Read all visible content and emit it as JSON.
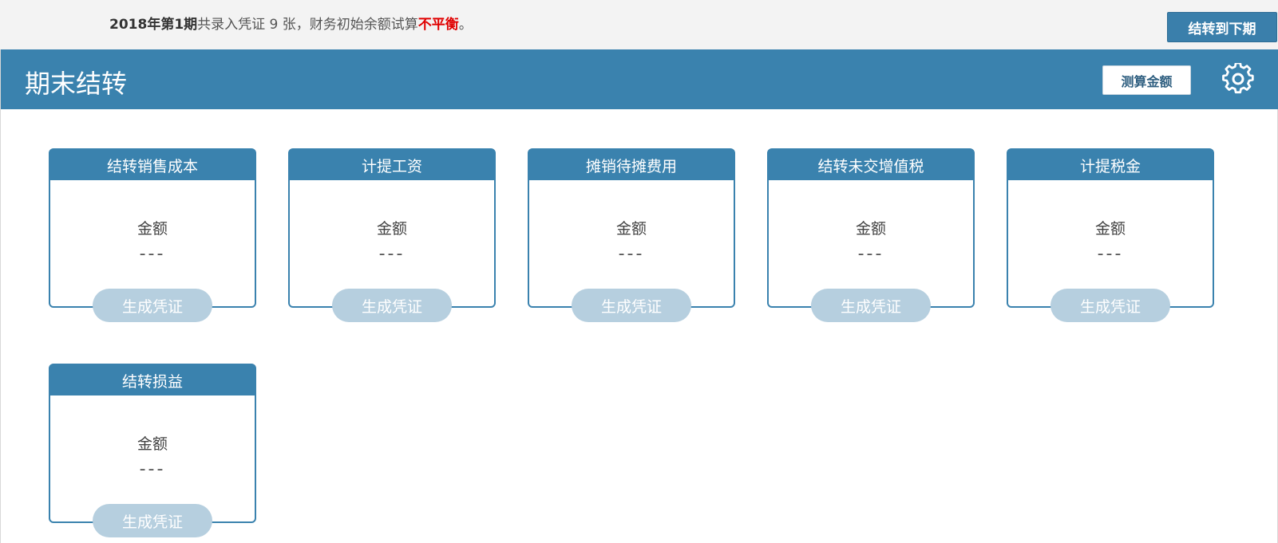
{
  "topbar": {
    "period": "2018年第1期",
    "text_mid": "共录入凭证 9 张，财务初始余额试算",
    "status": "不平衡",
    "text_end": "。",
    "next_period_button": "结转到下期"
  },
  "header": {
    "title": "期末结转",
    "calc_button": "测算金额",
    "settings_icon": "gear-icon"
  },
  "cards": [
    {
      "title": "结转销售成本",
      "amount_label": "金额",
      "amount_value": "---",
      "button": "生成凭证"
    },
    {
      "title": "计提工资",
      "amount_label": "金额",
      "amount_value": "---",
      "button": "生成凭证"
    },
    {
      "title": "摊销待摊费用",
      "amount_label": "金额",
      "amount_value": "---",
      "button": "生成凭证"
    },
    {
      "title": "结转未交增值税",
      "amount_label": "金额",
      "amount_value": "---",
      "button": "生成凭证"
    },
    {
      "title": "计提税金",
      "amount_label": "金额",
      "amount_value": "---",
      "button": "生成凭证"
    },
    {
      "title": "结转损益",
      "amount_label": "金额",
      "amount_value": "---",
      "button": "生成凭证"
    }
  ],
  "colors": {
    "header_bg": "#3a82ae",
    "status_bad": "#e00000",
    "generate_button": "#b6cfdf"
  }
}
